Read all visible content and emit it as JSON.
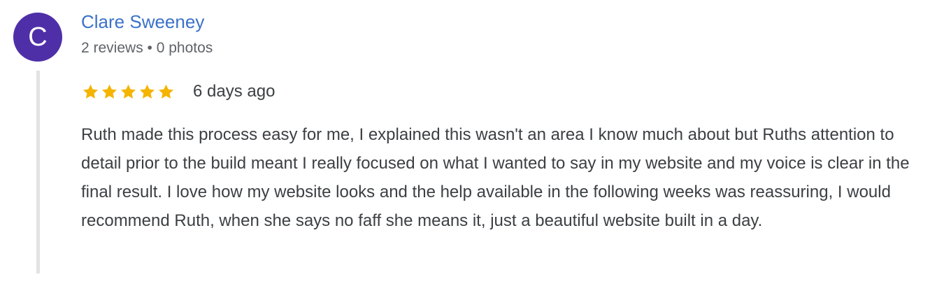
{
  "reviewer": {
    "initial": "C",
    "avatar_color": "#4f2fa8",
    "name": "Clare Sweeney",
    "name_color": "#3b72c9",
    "meta": "2 reviews • 0 photos"
  },
  "review": {
    "rating": 5,
    "max_rating": 5,
    "star_color": "#f4b400",
    "age": "6 days ago",
    "text": "Ruth made this process easy for me, I explained this wasn't an area I know much about but Ruths attention to detail prior to the build meant I really focused on what I wanted to say in my website and my voice is clear in the final result. I love how my website looks and the help available in the following weeks was reassuring, I would recommend Ruth, when she says no faff she means it, just a beautiful website built in a day."
  }
}
